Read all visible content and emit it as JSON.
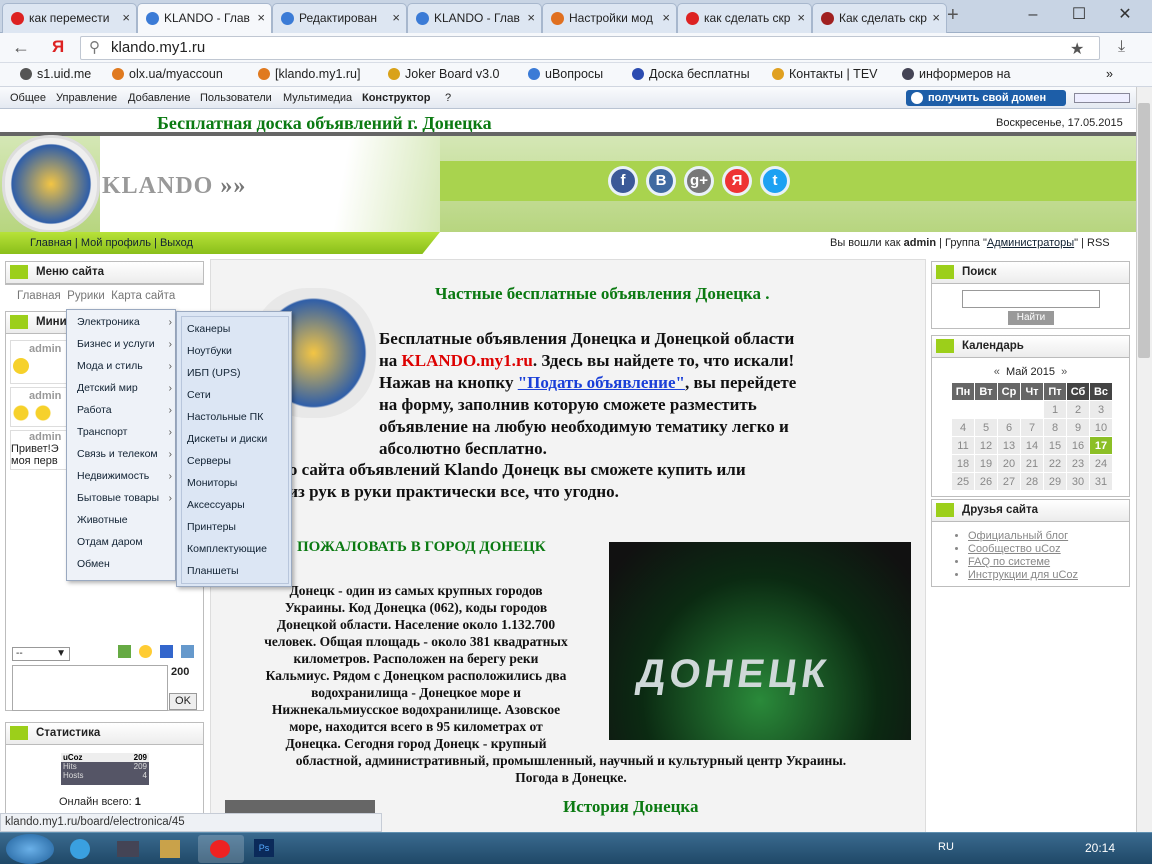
{
  "browser": {
    "tabs": [
      {
        "label": "как перемести",
        "icon": "yandex",
        "color": "#d22"
      },
      {
        "label": "KLANDO - Глав",
        "icon": "ucoz",
        "color": "#3b7bd6",
        "active": true
      },
      {
        "label": "Редактирован",
        "icon": "ucoz",
        "color": "#3b7bd6"
      },
      {
        "label": "KLANDO - Глав",
        "icon": "ucoz",
        "color": "#3b7bd6"
      },
      {
        "label": "Настройки мод",
        "icon": "orange",
        "color": "#e07020"
      },
      {
        "label": "как сделать скр",
        "icon": "yandex",
        "color": "#d22"
      },
      {
        "label": "Как сделать скр",
        "icon": "shield",
        "color": "#a02020"
      }
    ],
    "address": "klando.my1.ru",
    "bookmarks": [
      "s1.uid.me",
      "olx.ua/myaccoun",
      "[klando.my1.ru]",
      "Joker Board v3.0",
      "uВопросы",
      "Доска бесплатны",
      "Контакты | TEV",
      "информеров на"
    ],
    "status": "klando.my1.ru/board/electronica/45"
  },
  "ucozbar": {
    "menu": [
      "Общее",
      "Управление",
      "Добавление",
      "Пользователи",
      "Мультимедиа",
      "Конструктор",
      "?"
    ],
    "domain_button": "получить свой домен"
  },
  "header": {
    "title": "Бесплатная доска объявлений г. Донецка",
    "date": "Воскресенье, 17.05.2015",
    "logo": "KLANDO",
    "social": [
      "f",
      "В",
      "g+",
      "Я",
      "t"
    ]
  },
  "nav": {
    "links": "Главная | Мой профиль | Выход",
    "logged": "Вы вошли как",
    "user": "admin",
    "group_pre": "| Группа \"",
    "group": "Администраторы",
    "group_post": "\" | RSS"
  },
  "left": {
    "menu_title": "Меню сайта",
    "submenu": [
      "Главная",
      "Рурики",
      "Карта сайта"
    ],
    "mini_title": "Мини",
    "chat": [
      {
        "user": "admin"
      },
      {
        "user": "admin"
      },
      {
        "user": "admin",
        "text": "Привет!Э",
        "text2": "моя перв"
      }
    ],
    "select": "--",
    "counter": "200",
    "ok": "OK",
    "stats_title": "Статистика",
    "ucoz_label": "uCoz",
    "ucoz_nums": [
      "209",
      "209",
      "4"
    ],
    "hits": "Hits",
    "hosts": "Hosts",
    "online_label": "Онлайн всего:",
    "online": "1"
  },
  "menu": {
    "categories": [
      "Электроника",
      "Бизнес и услуги",
      "Мода и стиль",
      "Детский мир",
      "Работа",
      "Транспорт",
      "Связь и телеком",
      "Недвижимость",
      "Бытовые товары",
      "Животные",
      "Отдам даром",
      "Обмен"
    ],
    "electronics": [
      "Сканеры",
      "Ноутбуки",
      "ИБП (UPS)",
      "Сети",
      "Настольные ПК",
      "Дискеты и диски",
      "Серверы",
      "Мониторы",
      "Аксессуары",
      "Принтеры",
      "Комплектующие",
      "Планшеты"
    ]
  },
  "content": {
    "heading": "Частные бесплатные объявления Донецка .",
    "p1_a": "Бесплатные объявления Донецка и Донецкой области",
    "p1_b": "на",
    "p1_site": "KLANDO.my1.ru",
    "p1_c": ". Здесь вы найдете то, что искали!",
    "p1_d": "Нажав на кнопку",
    "p1_link": "\"Подать объявление\"",
    "p1_e": ", вы перейдете",
    "p1_f": "на форму, заполнив которую сможете разместить",
    "p1_g": "объявление на любую необходимую тематику легко и",
    "p1_h": "абсолютно бесплатно.",
    "p2": "щью сайта объявлений Klando Донецк вы сможете купить или",
    "p3": "ь из рук в руки практически все, что угодно.",
    "welcome": "ПОЖАЛОВАТЬ В ГОРОД ДОНЕЦК",
    "city_img_text": "ДОНЕЦК",
    "city_text": [
      "Донецк - один из самых крупных городов",
      "Украины. Код Донецка (062), коды городов",
      "Донецкой области. Население около 1.132.700",
      "человек. Общая площадь - около 381 квадратных",
      "километров. Расположен на берегу реки",
      "Кальмиус. Рядом с Донецком расположились два",
      "водохранилища - Донецкое море и",
      "Нижнекальмиусское водохранилище.  Азовское",
      "море, находится всего в 95 километрах от",
      "Донецка. Сегодня город Донецк - крупный"
    ],
    "city_text2": "областной, административный, промышленный, научный и культурный центр Украины.",
    "city_text3": "Погода в Донецке.",
    "history": "История Донецка"
  },
  "right": {
    "search_title": "Поиск",
    "search_btn": "Найти",
    "cal_title": "Календарь",
    "cal_month": "Май 2015",
    "cal_prev": "«",
    "cal_next": "»",
    "days": [
      "Пн",
      "Вт",
      "Ср",
      "Чт",
      "Пт",
      "Сб",
      "Вс"
    ],
    "weeks": [
      [
        "",
        "",
        "",
        "",
        "1",
        "2",
        "3"
      ],
      [
        "4",
        "5",
        "6",
        "7",
        "8",
        "9",
        "10"
      ],
      [
        "11",
        "12",
        "13",
        "14",
        "15",
        "16",
        "17"
      ],
      [
        "18",
        "19",
        "20",
        "21",
        "22",
        "23",
        "24"
      ],
      [
        "25",
        "26",
        "27",
        "28",
        "29",
        "30",
        "31"
      ]
    ],
    "today": "17",
    "friends_title": "Друзья сайта",
    "friends": [
      "Официальный блог",
      "Сообщество uCoz",
      "FAQ по системе",
      "Инструкции для uCoz"
    ]
  },
  "taskbar": {
    "lang": "RU",
    "time": "20:14"
  }
}
